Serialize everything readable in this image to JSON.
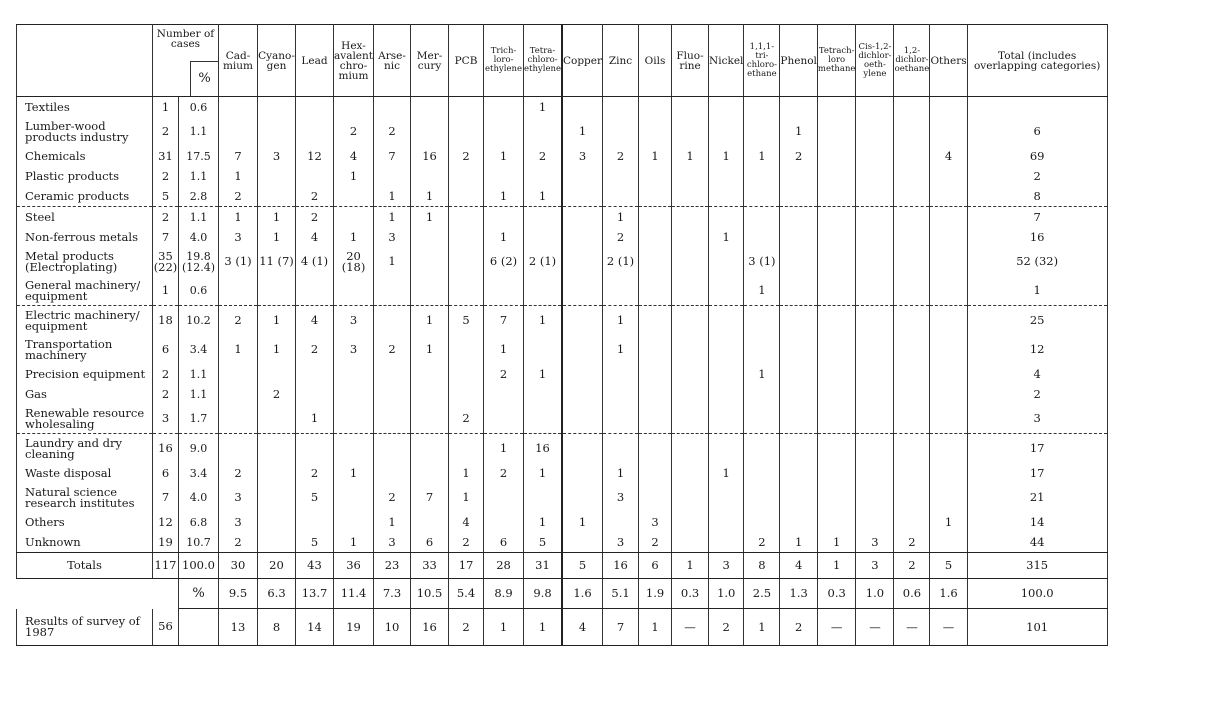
{
  "table": {
    "headers": {
      "cases_label": "Number of cases",
      "pct_label": "%",
      "columns": [
        "Cad-mium",
        "Cyano-gen",
        "Lead",
        "Hex-avalent chro-mium",
        "Arse-nic",
        "Mer-cury",
        "PCB",
        "Trich-loro-ethylene",
        "Tetra-chloro-ethylene",
        "Copper",
        "Zinc",
        "Oils",
        "Fluo-rine",
        "Nickel",
        "1,1,1-tri-chloro-ethane",
        "Phenol",
        "Tetrach-loro methane",
        "Cis-1,2-dichlor-oeth-ylene",
        "1,2-dichlor-oethane",
        "Others",
        "Total (includes overlapping categories)"
      ]
    },
    "rows": [
      {
        "label": "Textiles",
        "cases": "1",
        "pct": "0.6",
        "vals": [
          "",
          "",
          "",
          "",
          "",
          "",
          "",
          "",
          "1",
          "",
          "",
          "",
          "",
          "",
          "",
          "",
          "",
          "",
          "",
          "",
          ""
        ]
      },
      {
        "label": "Lumber-wood products industry",
        "cases": "2",
        "pct": "1.1",
        "vals": [
          "",
          "",
          "",
          "2",
          "2",
          "",
          "",
          "",
          "",
          "1",
          "",
          "",
          "",
          "",
          "",
          "1",
          "",
          "",
          "",
          "",
          "6"
        ]
      },
      {
        "label": "Chemicals",
        "cases": "31",
        "pct": "17.5",
        "vals": [
          "7",
          "3",
          "12",
          "4",
          "7",
          "16",
          "2",
          "1",
          "2",
          "3",
          "2",
          "1",
          "1",
          "1",
          "1",
          "2",
          "",
          "",
          "",
          "4",
          "69"
        ]
      },
      {
        "label": "Plastic products",
        "cases": "2",
        "pct": "1.1",
        "vals": [
          "1",
          "",
          "",
          "1",
          "",
          "",
          "",
          "",
          "",
          "",
          "",
          "",
          "",
          "",
          "",
          "",
          "",
          "",
          "",
          "",
          "2"
        ]
      },
      {
        "label": "Ceramic products",
        "cases": "5",
        "pct": "2.8",
        "vals": [
          "2",
          "",
          "2",
          "",
          "1",
          "1",
          "",
          "1",
          "1",
          "",
          "",
          "",
          "",
          "",
          "",
          "",
          "",
          "",
          "",
          "",
          "8"
        ]
      },
      {
        "label": "Steel",
        "cases": "2",
        "pct": "1.1",
        "vals": [
          "1",
          "1",
          "2",
          "",
          "1",
          "1",
          "",
          "",
          "",
          "",
          "1",
          "",
          "",
          "",
          "",
          "",
          "",
          "",
          "",
          "",
          "7"
        ]
      },
      {
        "label": "Non-ferrous metals",
        "cases": "7",
        "pct": "4.0",
        "vals": [
          "3",
          "1",
          "4",
          "1",
          "3",
          "",
          "",
          "1",
          "",
          "",
          "2",
          "",
          "",
          "1",
          "",
          "",
          "",
          "",
          "",
          "",
          "16"
        ]
      },
      {
        "label": "Metal products (Electroplating)",
        "cases": "35 (22)",
        "pct": "19.8 (12.4)",
        "vals": [
          "3 (1)",
          "11 (7)",
          "4 (1)",
          "20 (18)",
          "1",
          "",
          "",
          "6 (2)",
          "2 (1)",
          "",
          "2 (1)",
          "",
          "",
          "",
          "3 (1)",
          "",
          "",
          "",
          "",
          "",
          "52 (32)"
        ]
      },
      {
        "label": "General machinery/ equipment",
        "cases": "1",
        "pct": "0.6",
        "vals": [
          "",
          "",
          "",
          "",
          "",
          "",
          "",
          "",
          "",
          "",
          "",
          "",
          "",
          "",
          "1",
          "",
          "",
          "",
          "",
          "",
          "1"
        ]
      },
      {
        "label": "Electric machinery/ equipment",
        "cases": "18",
        "pct": "10.2",
        "vals": [
          "2",
          "1",
          "4",
          "3",
          "",
          "1",
          "5",
          "7",
          "1",
          "",
          "1",
          "",
          "",
          "",
          "",
          "",
          "",
          "",
          "",
          "",
          "25"
        ]
      },
      {
        "label": "Transportation machinery",
        "cases": "6",
        "pct": "3.4",
        "vals": [
          "1",
          "1",
          "2",
          "3",
          "2",
          "1",
          "",
          "1",
          "",
          "",
          "1",
          "",
          "",
          "",
          "",
          "",
          "",
          "",
          "",
          "",
          "12"
        ]
      },
      {
        "label": "Precision equipment",
        "cases": "2",
        "pct": "1.1",
        "vals": [
          "",
          "",
          "",
          "",
          "",
          "",
          "",
          "2",
          "1",
          "",
          "",
          "",
          "",
          "",
          "1",
          "",
          "",
          "",
          "",
          "",
          "4"
        ]
      },
      {
        "label": "Gas",
        "cases": "2",
        "pct": "1.1",
        "vals": [
          "",
          "2",
          "",
          "",
          "",
          "",
          "",
          "",
          "",
          "",
          "",
          "",
          "",
          "",
          "",
          "",
          "",
          "",
          "",
          "",
          "2"
        ]
      },
      {
        "label": "Renewable resource wholesaling",
        "cases": "3",
        "pct": "1.7",
        "vals": [
          "",
          "",
          "1",
          "",
          "",
          "",
          "2",
          "",
          "",
          "",
          "",
          "",
          "",
          "",
          "",
          "",
          "",
          "",
          "",
          "",
          "3"
        ]
      },
      {
        "label": "Laundry and dry cleaning",
        "cases": "16",
        "pct": "9.0",
        "vals": [
          "",
          "",
          "",
          "",
          "",
          "",
          "",
          "1",
          "16",
          "",
          "",
          "",
          "",
          "",
          "",
          "",
          "",
          "",
          "",
          "",
          "17"
        ]
      },
      {
        "label": "Waste disposal",
        "cases": "6",
        "pct": "3.4",
        "vals": [
          "2",
          "",
          "2",
          "1",
          "",
          "",
          "1",
          "2",
          "1",
          "",
          "1",
          "",
          "",
          "1",
          "",
          "",
          "",
          "",
          "",
          "",
          "17"
        ]
      },
      {
        "label": "Natural science research institutes",
        "cases": "7",
        "pct": "4.0",
        "vals": [
          "3",
          "",
          "5",
          "",
          "2",
          "7",
          "1",
          "",
          "",
          "",
          "3",
          "",
          "",
          "",
          "",
          "",
          "",
          "",
          "",
          "",
          "21"
        ]
      },
      {
        "label": "Others",
        "cases": "12",
        "pct": "6.8",
        "vals": [
          "3",
          "",
          "",
          "",
          "1",
          "",
          "4",
          "",
          "1",
          "1",
          "",
          "3",
          "",
          "",
          "",
          "",
          "",
          "",
          "",
          "1",
          "14"
        ]
      },
      {
        "label": "Unknown",
        "cases": "19",
        "pct": "10.7",
        "vals": [
          "2",
          "",
          "5",
          "1",
          "3",
          "6",
          "2",
          "6",
          "5",
          "",
          "3",
          "2",
          "",
          "",
          "2",
          "1",
          "1",
          "3",
          "2",
          "",
          "44"
        ]
      }
    ],
    "totals": {
      "label": "Totals",
      "cases": "117",
      "pct": "100.0",
      "vals": [
        "30",
        "20",
        "43",
        "36",
        "23",
        "33",
        "17",
        "28",
        "31",
        "5",
        "16",
        "6",
        "1",
        "3",
        "8",
        "4",
        "1",
        "3",
        "2",
        "5",
        "315"
      ]
    },
    "percent_row": {
      "label": "%",
      "vals": [
        "9.5",
        "6.3",
        "13.7",
        "11.4",
        "7.3",
        "10.5",
        "5.4",
        "8.9",
        "9.8",
        "1.6",
        "5.1",
        "1.9",
        "0.3",
        "1.0",
        "2.5",
        "1.3",
        "0.3",
        "1.0",
        "0.6",
        "1.6",
        "100.0"
      ]
    },
    "survey_1987": {
      "label": "Results of survey of 1987",
      "cases": "56",
      "pct": "",
      "vals": [
        "13",
        "8",
        "14",
        "19",
        "10",
        "16",
        "2",
        "1",
        "1",
        "4",
        "7",
        "1",
        "—",
        "2",
        "1",
        "2",
        "—",
        "—",
        "—",
        "—",
        "101"
      ]
    }
  }
}
